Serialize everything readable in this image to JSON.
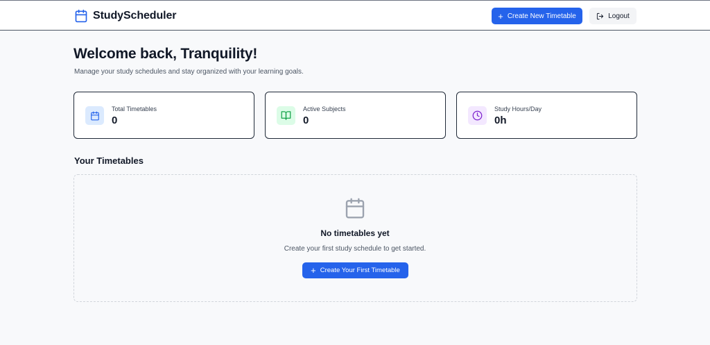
{
  "header": {
    "brand_name": "StudyScheduler",
    "brand_icon": "calendar-icon",
    "create_button_label": "Create New Timetable",
    "logout_label": "Logout"
  },
  "welcome": {
    "title": "Welcome back, Tranquility!",
    "subtitle": "Manage your study schedules and stay organized with your learning goals."
  },
  "stats": [
    {
      "label": "Total Timetables",
      "value": "0",
      "icon": "calendar-icon",
      "color": "#2563eb",
      "bg": "#dbeafe"
    },
    {
      "label": "Active Subjects",
      "value": "0",
      "icon": "book-open-icon",
      "color": "#16a34a",
      "bg": "#dcfce7"
    },
    {
      "label": "Study Hours/Day",
      "value": "0h",
      "icon": "clock-icon",
      "color": "#7e22ce",
      "bg": "#f3e8ff"
    }
  ],
  "timetables": {
    "section_title": "Your Timetables",
    "empty_title": "No timetables yet",
    "empty_subtitle": "Create your first study schedule to get started.",
    "create_first_label": "Create Your First Timetable"
  },
  "colors": {
    "primary": "#2563eb",
    "background": "#f8f9fb",
    "text": "#111827"
  }
}
